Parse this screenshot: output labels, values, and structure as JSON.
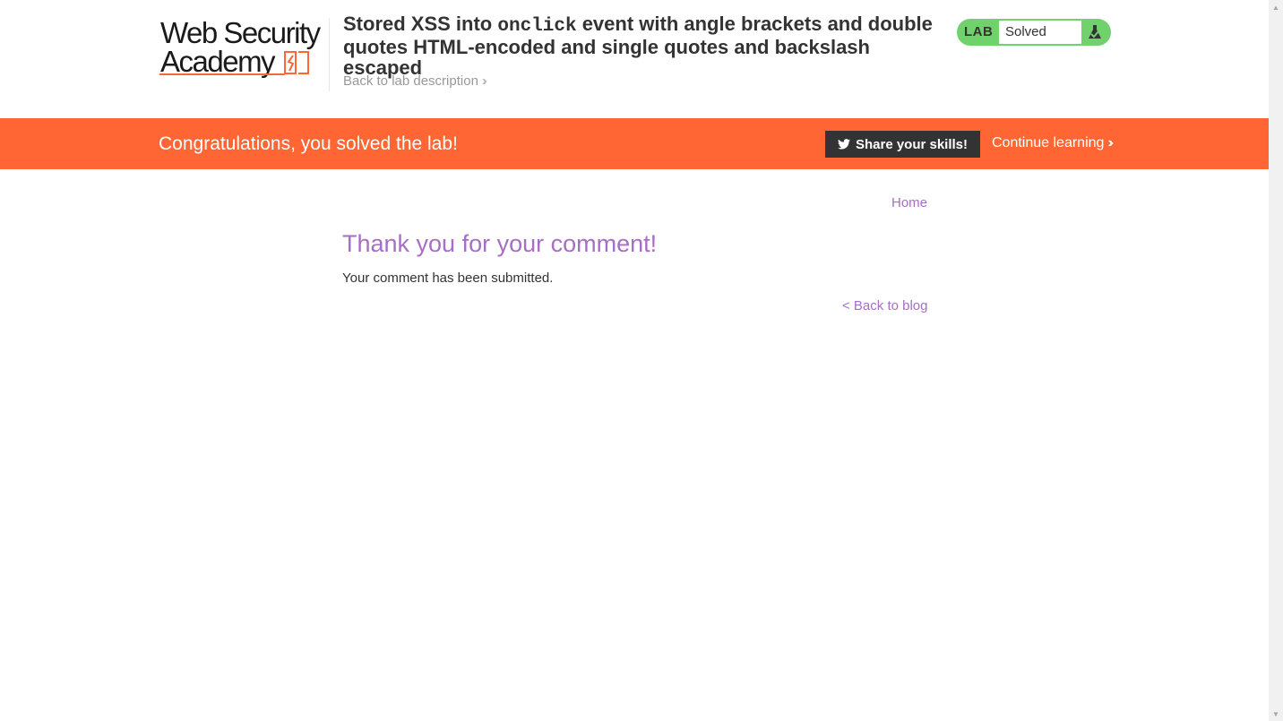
{
  "header": {
    "logo": {
      "line1": "Web Security",
      "line2": "Academy"
    },
    "lab_title": {
      "part1": "Stored XSS into ",
      "code": "onclick",
      "part2": " event with angle brackets and double quotes HTML-encoded and single quotes and backslash escaped"
    },
    "back_to_description": "Back to lab description",
    "status": {
      "badge": "LAB",
      "text": "Solved"
    }
  },
  "banner": {
    "message": "Congratulations, you solved the lab!",
    "share_button": "Share your skills!",
    "continue_link": "Continue learning"
  },
  "nav": {
    "home": "Home"
  },
  "main": {
    "title": "Thank you for your comment!",
    "message": "Your comment has been submitted.",
    "back_link": "< Back to blog"
  },
  "colors": {
    "accent_orange": "#ff6633",
    "link_purple": "#a66ec4",
    "solved_green": "#70d16d",
    "dark_button": "#333333"
  },
  "icons": [
    "academy-logo-mark",
    "double-chevron-right-icon",
    "lab-flask-icon",
    "twitter-icon"
  ]
}
